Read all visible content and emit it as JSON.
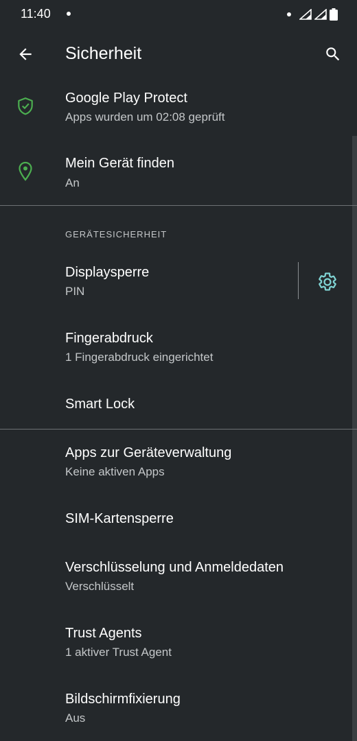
{
  "status_bar": {
    "time": "11:40"
  },
  "app_bar": {
    "title": "Sicherheit"
  },
  "items": {
    "play_protect": {
      "title": "Google Play Protect",
      "summary": "Apps wurden um 02:08 geprüft"
    },
    "find_device": {
      "title": "Mein Gerät finden",
      "summary": "An"
    },
    "screen_lock": {
      "title": "Displaysperre",
      "summary": "PIN"
    },
    "fingerprint": {
      "title": "Fingerabdruck",
      "summary": "1 Fingerabdruck eingerichtet"
    },
    "smart_lock": {
      "title": "Smart Lock"
    },
    "device_admin": {
      "title": "Apps zur Geräteverwaltung",
      "summary": "Keine aktiven Apps"
    },
    "sim_lock": {
      "title": "SIM-Kartensperre"
    },
    "encryption": {
      "title": "Verschlüsselung und Anmeldedaten",
      "summary": "Verschlüsselt"
    },
    "trust_agents": {
      "title": "Trust Agents",
      "summary": "1 aktiver Trust Agent"
    },
    "screen_pinning": {
      "title": "Bildschirmfixierung",
      "summary": "Aus"
    }
  },
  "section": {
    "device_security": "GERÄTESICHERHEIT"
  },
  "icons": {
    "back": "arrow-back-icon",
    "search": "search-icon",
    "play_protect": "shield-check-icon",
    "find_device": "location-pin-icon",
    "screen_lock_settings": "gear-icon"
  },
  "colors": {
    "background": "#24282b",
    "accent_green": "#4caf50",
    "accent_teal": "#7fd3d3"
  }
}
